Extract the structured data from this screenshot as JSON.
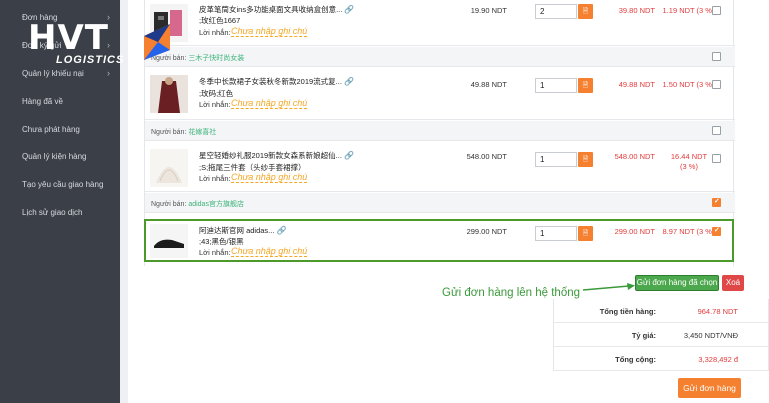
{
  "sidebar": {
    "items": [
      {
        "label": "Đơn hàng",
        "chevron": true
      },
      {
        "label": "Đơn ký gửi",
        "chevron": true
      },
      {
        "label": "Quản lý khiếu nại",
        "chevron": true
      },
      {
        "label": "Hàng đã về",
        "chevron": false
      },
      {
        "label": "Chưa phát hàng",
        "chevron": false
      },
      {
        "label": "Quản lý kiện hàng",
        "chevron": false
      },
      {
        "label": "Tạo yêu cầu giao hàng",
        "chevron": false
      },
      {
        "label": "Lịch sử giao dịch",
        "chevron": false
      }
    ]
  },
  "logo": {
    "text": "HVT",
    "subtext": "LOGISTICS"
  },
  "seller_label": "Người bán:",
  "note_label": "Lời nhắn:",
  "note_placeholder": "Chưa nhập ghi chú",
  "products": [
    {
      "name": "皮革笔筒女ins多功能桌面文具收纳盒创意...",
      "attr": ";玫红色1667",
      "price": "19.90 NDT",
      "qty": "2",
      "total": "39.80 NDT",
      "fee": "1.19 NDT (3 %)",
      "checked": false
    },
    {
      "name": "冬季中长款裙子女装秋冬新款2019流式复...",
      "attr": ";玫码;红色",
      "price": "49.88 NDT",
      "qty": "1",
      "total": "49.88 NDT",
      "fee": "1.50 NDT (3 %)",
      "checked": false
    },
    {
      "name": "星空轻婚纱礼服2019新款女森系新娘超仙...",
      "attr": ";S;拖尾三件套（头纱手套裙撑）",
      "price": "548.00 NDT",
      "qty": "1",
      "total": "548.00 NDT",
      "fee": "16.44 NDT (3 %)",
      "checked": false
    },
    {
      "name": "阿迪达斯官网 adidas...",
      "attr": ";43;黑色/银黑",
      "price": "299.00 NDT",
      "qty": "1",
      "total": "299.00 NDT",
      "fee": "8.97 NDT (3 %)",
      "checked": true
    }
  ],
  "sellers": [
    {
      "name": "三木子快时尚女装",
      "checked": false
    },
    {
      "name": "花嫁喜社",
      "checked": false
    },
    {
      "name": "adidas官方旗舰店",
      "checked": true
    }
  ],
  "actions": {
    "submit_selected": "Gửi đơn hàng đã chọn",
    "delete": "Xoá",
    "send_order": "Gửi đơn hàng"
  },
  "annotation": "Gửi đơn hàng lên hệ thống",
  "summary": {
    "total_label": "Tổng tiền hàng:",
    "total_value": "964.78 NDT",
    "rate_label": "Tỷ giá:",
    "rate_value": "3,450 NDT/VNĐ",
    "grand_label": "Tổng cộng:",
    "grand_value": "3,328,492 đ"
  },
  "colors": {
    "accent": "#f48030",
    "green": "#4ca84c",
    "red": "#e23b3b",
    "sidebar": "#3b3f47"
  }
}
